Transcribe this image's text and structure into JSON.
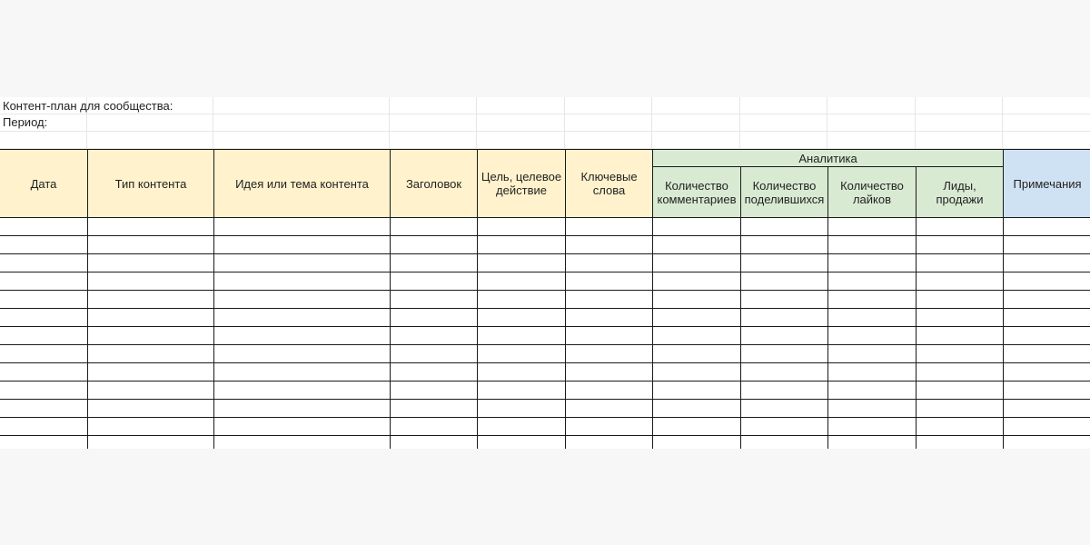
{
  "meta": {
    "community_label": "Контент-план для сообщества:",
    "period_label": "Период:"
  },
  "headers": {
    "date": "Дата",
    "content_type": "Тип контента",
    "idea": "Идея или тема контента",
    "title": "Заголовок",
    "goal": "Цель, целевое действие",
    "keywords": "Ключевые слова",
    "analytics": "Аналитика",
    "comments": "Количество комментариев",
    "shares": "Количество поделившихся",
    "likes": "Количество лайков",
    "leads": "Лиды, продажи",
    "notes": "Примечания"
  },
  "colors": {
    "planning_header": "#fff2cc",
    "analytics_header": "#d9ead3",
    "notes_header": "#cfe2f3"
  },
  "empty_rows": 13
}
